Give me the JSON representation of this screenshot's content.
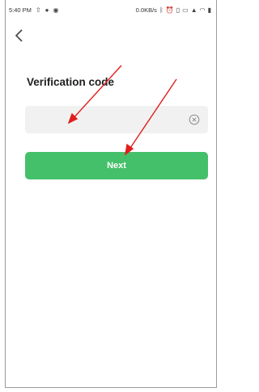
{
  "status_bar": {
    "time": "5:40 PM",
    "network_speed": "0.0KB/s",
    "icons": [
      "upload-icon",
      "circle-icon",
      "dot-icon",
      "bluetooth-icon",
      "alarm-icon",
      "vibrate-icon",
      "hd-icon",
      "signal-icon",
      "wifi-icon",
      "battery-icon"
    ]
  },
  "header": {
    "back_icon": "back-arrow-icon"
  },
  "form": {
    "title": "Verification code",
    "input": {
      "value": "",
      "placeholder": ""
    },
    "clear_icon": "clear-circle-icon",
    "next_label": "Next"
  },
  "annotations": {
    "arrow_color": "#e11d1d",
    "count": 2
  },
  "colors": {
    "accent": "#45c06a",
    "input_bg": "#f1f1f1"
  }
}
